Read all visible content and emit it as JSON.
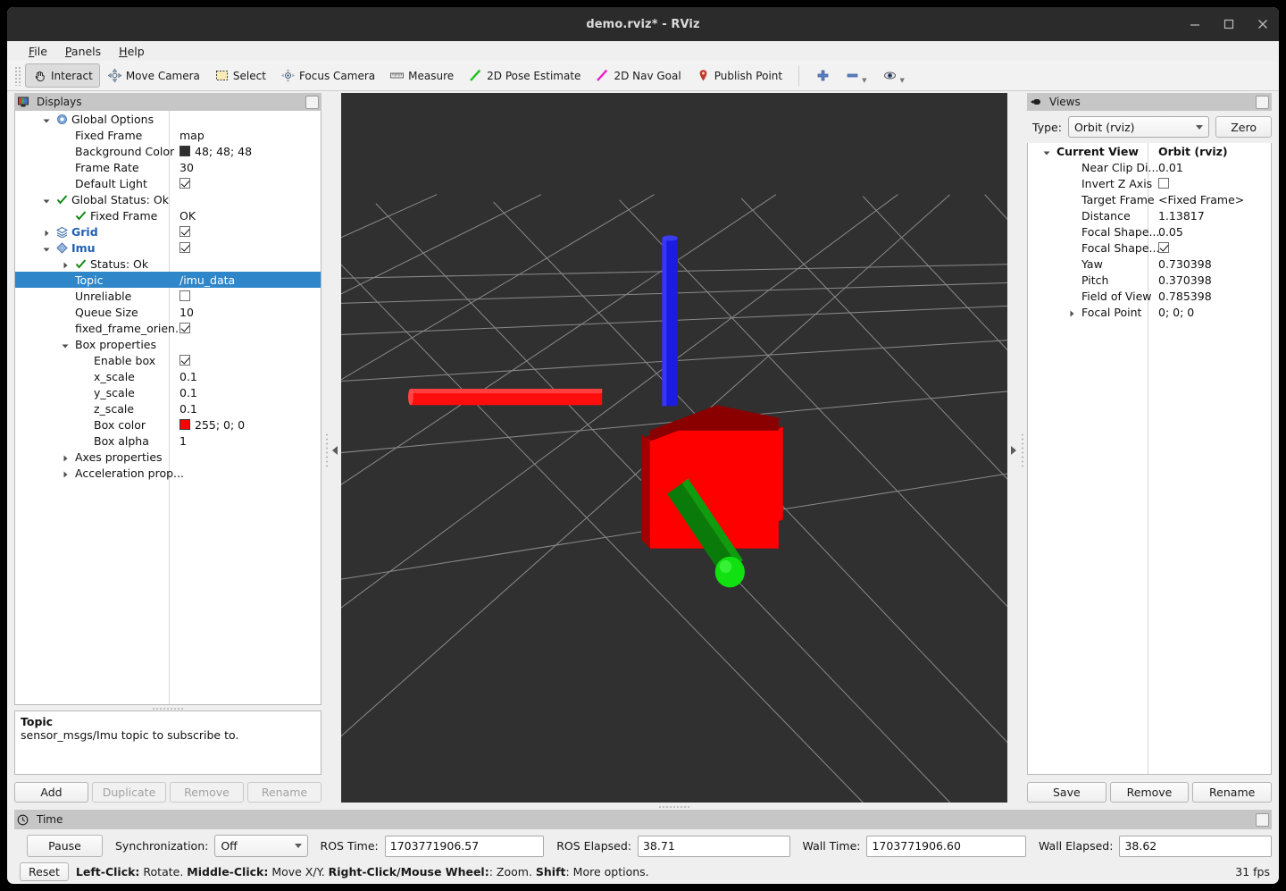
{
  "window": {
    "title": "demo.rviz* - RViz",
    "minimize": "minimize-icon",
    "maximize": "maximize-icon",
    "close": "close-icon"
  },
  "menubar": {
    "items": [
      "File",
      "Panels",
      "Help"
    ]
  },
  "toolbar": {
    "buttons": [
      {
        "label": "Interact",
        "icon": "hand-cursor-icon",
        "checked": true
      },
      {
        "label": "Move Camera",
        "icon": "move-camera-icon",
        "checked": false
      },
      {
        "label": "Select",
        "icon": "select-rect-icon",
        "checked": false
      },
      {
        "label": "Focus Camera",
        "icon": "focus-camera-icon",
        "checked": false
      },
      {
        "label": "Measure",
        "icon": "ruler-icon",
        "checked": false
      },
      {
        "label": "2D Pose Estimate",
        "icon": "pose-arrow-green-icon",
        "checked": false
      },
      {
        "label": "2D Nav Goal",
        "icon": "nav-goal-arrow-magenta-icon",
        "checked": false
      },
      {
        "label": "Publish Point",
        "icon": "map-pin-icon",
        "checked": false
      }
    ],
    "extras": [
      {
        "icon": "plus-icon",
        "label": ""
      },
      {
        "icon": "minus-icon",
        "label": ""
      },
      {
        "icon": "eye-icon",
        "label": ""
      }
    ]
  },
  "displays": {
    "header": {
      "title": "Displays",
      "icon": "displays-monitor-icon",
      "float_button": "float-panel-button"
    },
    "rows": [
      {
        "label": "Global Options",
        "value": "",
        "indent": 1,
        "arrow": "down",
        "icon": "gear-icon",
        "style": "plain",
        "type": "text"
      },
      {
        "label": "Fixed Frame",
        "value": "map",
        "indent": 2,
        "arrow": "",
        "icon": "",
        "style": "plain",
        "type": "text"
      },
      {
        "label": "Background Color",
        "value": "48; 48; 48",
        "indent": 2,
        "arrow": "",
        "icon": "",
        "style": "plain",
        "type": "color",
        "color": "#303030"
      },
      {
        "label": "Frame Rate",
        "value": "30",
        "indent": 2,
        "arrow": "",
        "icon": "",
        "style": "plain",
        "type": "text"
      },
      {
        "label": "Default Light",
        "value": "",
        "indent": 2,
        "arrow": "",
        "icon": "",
        "style": "plain",
        "type": "checkbox",
        "checked": true
      },
      {
        "label": "Global Status: Ok",
        "value": "",
        "indent": 1,
        "arrow": "down",
        "icon": "check-green-icon",
        "style": "plain",
        "type": "text"
      },
      {
        "label": "Fixed Frame",
        "value": "OK",
        "indent": 2,
        "arrow": "",
        "icon": "check-green-icon",
        "style": "plain",
        "type": "text"
      },
      {
        "label": "Grid",
        "value": "",
        "indent": 1,
        "arrow": "right",
        "icon": "grid-icon",
        "style": "blue",
        "type": "checkbox",
        "checked": true
      },
      {
        "label": "Imu",
        "value": "",
        "indent": 1,
        "arrow": "down",
        "icon": "imu-diamond-icon",
        "style": "blue",
        "type": "checkbox",
        "checked": true
      },
      {
        "label": "Status: Ok",
        "value": "",
        "indent": 2,
        "arrow": "right",
        "icon": "check-green-icon",
        "style": "plain",
        "type": "text"
      },
      {
        "label": "Topic",
        "value": "/imu_data",
        "indent": 2,
        "arrow": "",
        "icon": "",
        "style": "selected",
        "type": "text"
      },
      {
        "label": "Unreliable",
        "value": "",
        "indent": 2,
        "arrow": "",
        "icon": "",
        "style": "plain",
        "type": "checkbox",
        "checked": false
      },
      {
        "label": "Queue Size",
        "value": "10",
        "indent": 2,
        "arrow": "",
        "icon": "",
        "style": "plain",
        "type": "text"
      },
      {
        "label": "fixed_frame_orien...",
        "value": "",
        "indent": 2,
        "arrow": "",
        "icon": "",
        "style": "plain",
        "type": "checkbox",
        "checked": true
      },
      {
        "label": "Box properties",
        "value": "",
        "indent": 2,
        "arrow": "down",
        "icon": "",
        "style": "plain",
        "type": "text"
      },
      {
        "label": "Enable box",
        "value": "",
        "indent": 3,
        "arrow": "",
        "icon": "",
        "style": "plain",
        "type": "checkbox",
        "checked": true
      },
      {
        "label": "x_scale",
        "value": "0.1",
        "indent": 3,
        "arrow": "",
        "icon": "",
        "style": "plain",
        "type": "text"
      },
      {
        "label": "y_scale",
        "value": "0.1",
        "indent": 3,
        "arrow": "",
        "icon": "",
        "style": "plain",
        "type": "text"
      },
      {
        "label": "z_scale",
        "value": "0.1",
        "indent": 3,
        "arrow": "",
        "icon": "",
        "style": "plain",
        "type": "text"
      },
      {
        "label": "Box color",
        "value": "255; 0; 0",
        "indent": 3,
        "arrow": "",
        "icon": "",
        "style": "plain",
        "type": "color",
        "color": "#ff0000"
      },
      {
        "label": "Box alpha",
        "value": "1",
        "indent": 3,
        "arrow": "",
        "icon": "",
        "style": "plain",
        "type": "text"
      },
      {
        "label": "Axes properties",
        "value": "",
        "indent": 2,
        "arrow": "right",
        "icon": "",
        "style": "plain",
        "type": "text"
      },
      {
        "label": "Acceleration prop...",
        "value": "",
        "indent": 2,
        "arrow": "right",
        "icon": "",
        "style": "plain",
        "type": "text"
      }
    ],
    "description": {
      "title": "Topic",
      "text": "sensor_msgs/Imu topic to subscribe to."
    },
    "buttons": [
      {
        "label": "Add",
        "enabled": true
      },
      {
        "label": "Duplicate",
        "enabled": false
      },
      {
        "label": "Remove",
        "enabled": false
      },
      {
        "label": "Rename",
        "enabled": false
      }
    ]
  },
  "views": {
    "header": {
      "title": "Views",
      "icon": "views-camera-icon",
      "float_button": "float-panel-button"
    },
    "type_label": "Type:",
    "type_value": "Orbit (rviz)",
    "zero_button": "Zero",
    "rows": [
      {
        "label": "Current View",
        "value": "Orbit (rviz)",
        "indent": 1,
        "arrow": "down",
        "style": "bold",
        "type": "text"
      },
      {
        "label": "Near Clip Di...",
        "value": "0.01",
        "indent": 2,
        "arrow": "",
        "style": "plain",
        "type": "text"
      },
      {
        "label": "Invert Z Axis",
        "value": "",
        "indent": 2,
        "arrow": "",
        "style": "plain",
        "type": "checkbox",
        "checked": false
      },
      {
        "label": "Target Frame",
        "value": "<Fixed Frame>",
        "indent": 2,
        "arrow": "",
        "style": "plain",
        "type": "text"
      },
      {
        "label": "Distance",
        "value": "1.13817",
        "indent": 2,
        "arrow": "",
        "style": "plain",
        "type": "text"
      },
      {
        "label": "Focal Shape...",
        "value": "0.05",
        "indent": 2,
        "arrow": "",
        "style": "plain",
        "type": "text"
      },
      {
        "label": "Focal Shape...",
        "value": "",
        "indent": 2,
        "arrow": "",
        "style": "plain",
        "type": "checkbox",
        "checked": true
      },
      {
        "label": "Yaw",
        "value": "0.730398",
        "indent": 2,
        "arrow": "",
        "style": "plain",
        "type": "text"
      },
      {
        "label": "Pitch",
        "value": "0.370398",
        "indent": 2,
        "arrow": "",
        "style": "plain",
        "type": "text"
      },
      {
        "label": "Field of View",
        "value": "0.785398",
        "indent": 2,
        "arrow": "",
        "style": "plain",
        "type": "text"
      },
      {
        "label": "Focal Point",
        "value": "0; 0; 0",
        "indent": 2,
        "arrow": "right",
        "style": "plain",
        "type": "text"
      }
    ],
    "buttons": [
      {
        "label": "Save",
        "enabled": true
      },
      {
        "label": "Remove",
        "enabled": true
      },
      {
        "label": "Rename",
        "enabled": true
      }
    ]
  },
  "viewport": {
    "background_color": "#303030",
    "grid_color": "#9a9a9a",
    "box_color": "#ff0000",
    "axis_x_color": "#ff0000",
    "axis_y_color": "#009000",
    "axis_z_color": "#2020e0"
  },
  "time": {
    "header": {
      "title": "Time",
      "icon": "clock-icon",
      "float_button": "float-panel-button"
    },
    "pause_button": "Pause",
    "sync_label": "Synchronization:",
    "sync_value": "Off",
    "fields": [
      {
        "label": "ROS Time:",
        "value": "1703771906.57"
      },
      {
        "label": "ROS Elapsed:",
        "value": "38.71"
      },
      {
        "label": "Wall Time:",
        "value": "1703771906.60"
      },
      {
        "label": "Wall Elapsed:",
        "value": "38.62"
      }
    ]
  },
  "statusbar": {
    "reset_button": "Reset",
    "hint_parts": [
      {
        "text": "Left-Click:",
        "bold": true
      },
      {
        "text": " Rotate. ",
        "bold": false
      },
      {
        "text": "Middle-Click:",
        "bold": true
      },
      {
        "text": " Move X/Y. ",
        "bold": false
      },
      {
        "text": "Right-Click/Mouse Wheel:",
        "bold": true
      },
      {
        "text": ": Zoom. ",
        "bold": false
      },
      {
        "text": "Shift",
        "bold": true
      },
      {
        "text": ": More options.",
        "bold": false
      }
    ],
    "fps": "31 fps"
  }
}
